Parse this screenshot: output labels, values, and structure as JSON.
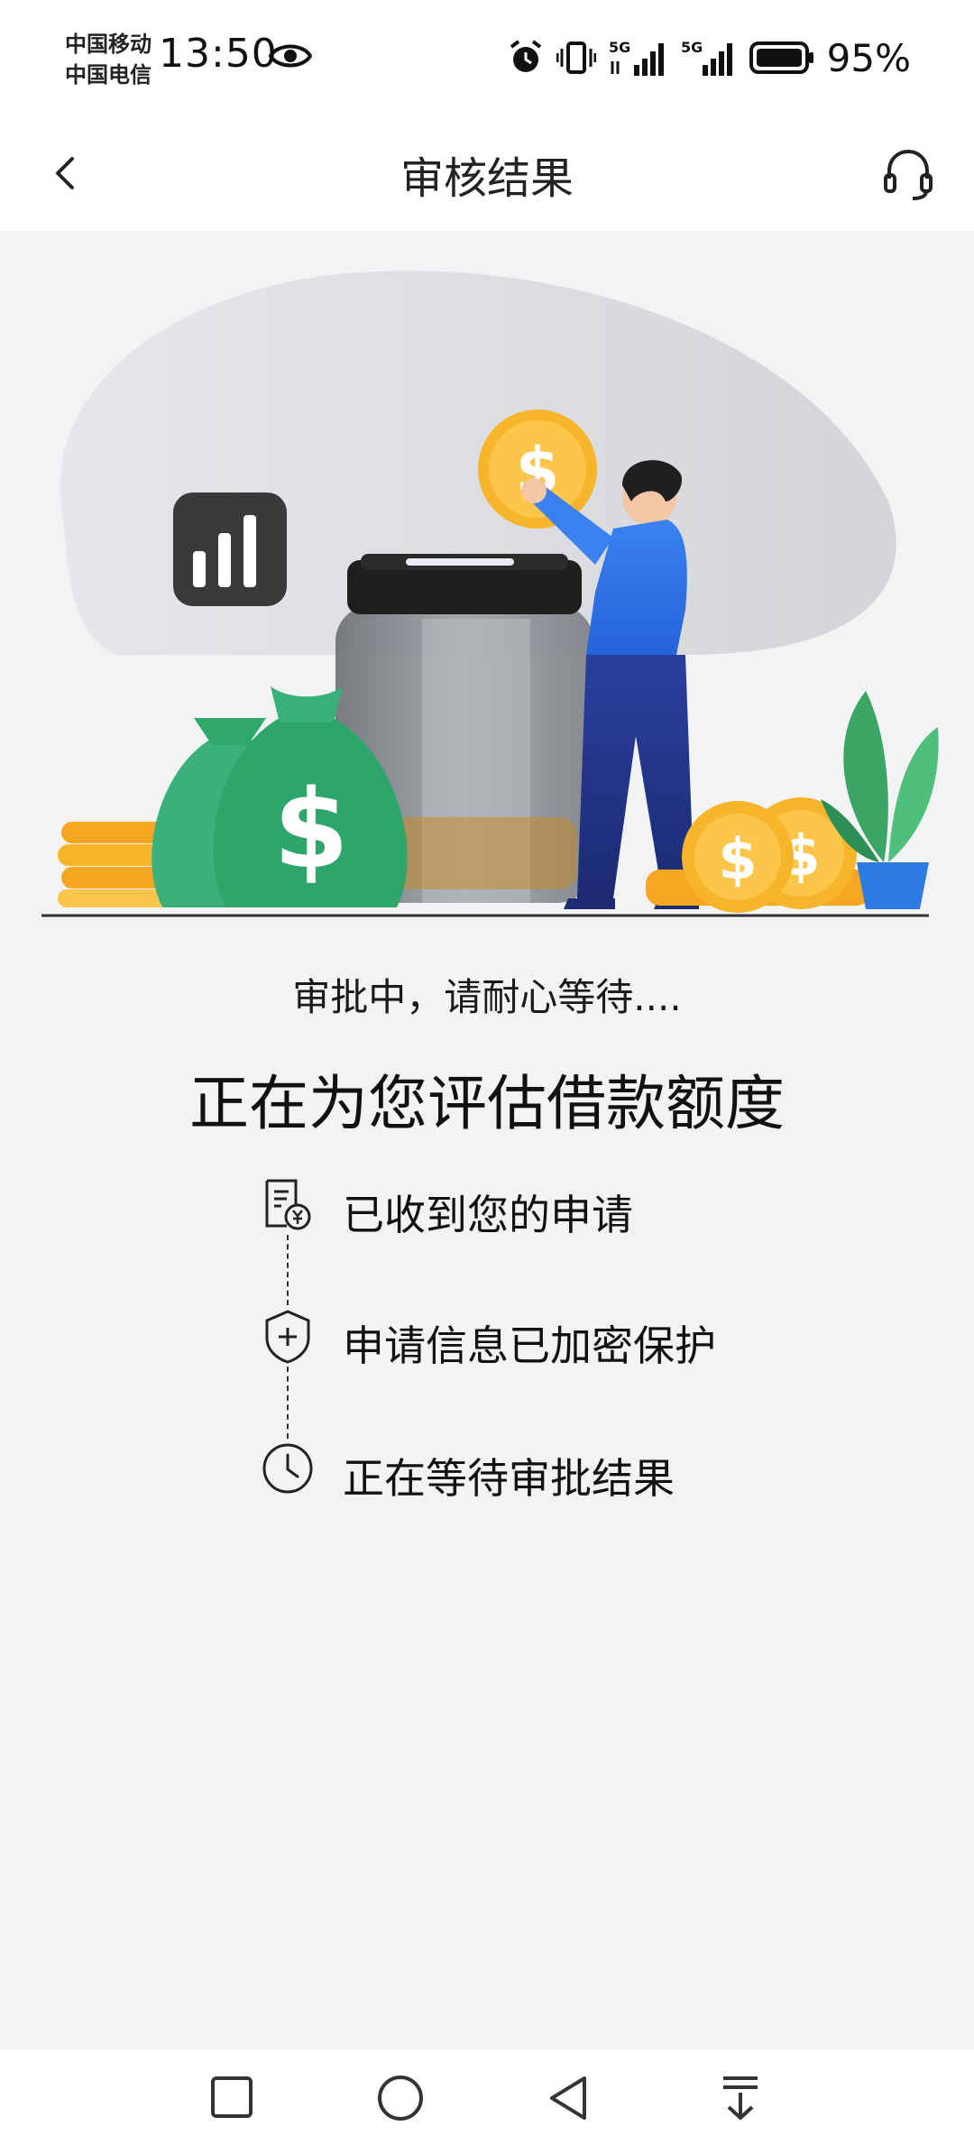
{
  "status_bar": {
    "carrier_1": "中国移动",
    "carrier_2": "中国电信",
    "time": "13:50",
    "network_1": "5G",
    "network_2": "5G",
    "battery": "95%"
  },
  "nav": {
    "title": "审核结果"
  },
  "status": {
    "subtitle": "审批中，请耐心等待....",
    "headline": "正在为您评估借款额度"
  },
  "steps": [
    {
      "label": "已收到您的申请",
      "icon": "receipt-yen-icon"
    },
    {
      "label": "申请信息已加密保护",
      "icon": "shield-plus-icon"
    },
    {
      "label": "正在等待审批结果",
      "icon": "clock-icon"
    }
  ],
  "colors": {
    "accent_blue": "#2f6fe4",
    "money_green": "#2fa86e",
    "coin_gold": "#f7b52c",
    "background": "#f2f3f5"
  }
}
